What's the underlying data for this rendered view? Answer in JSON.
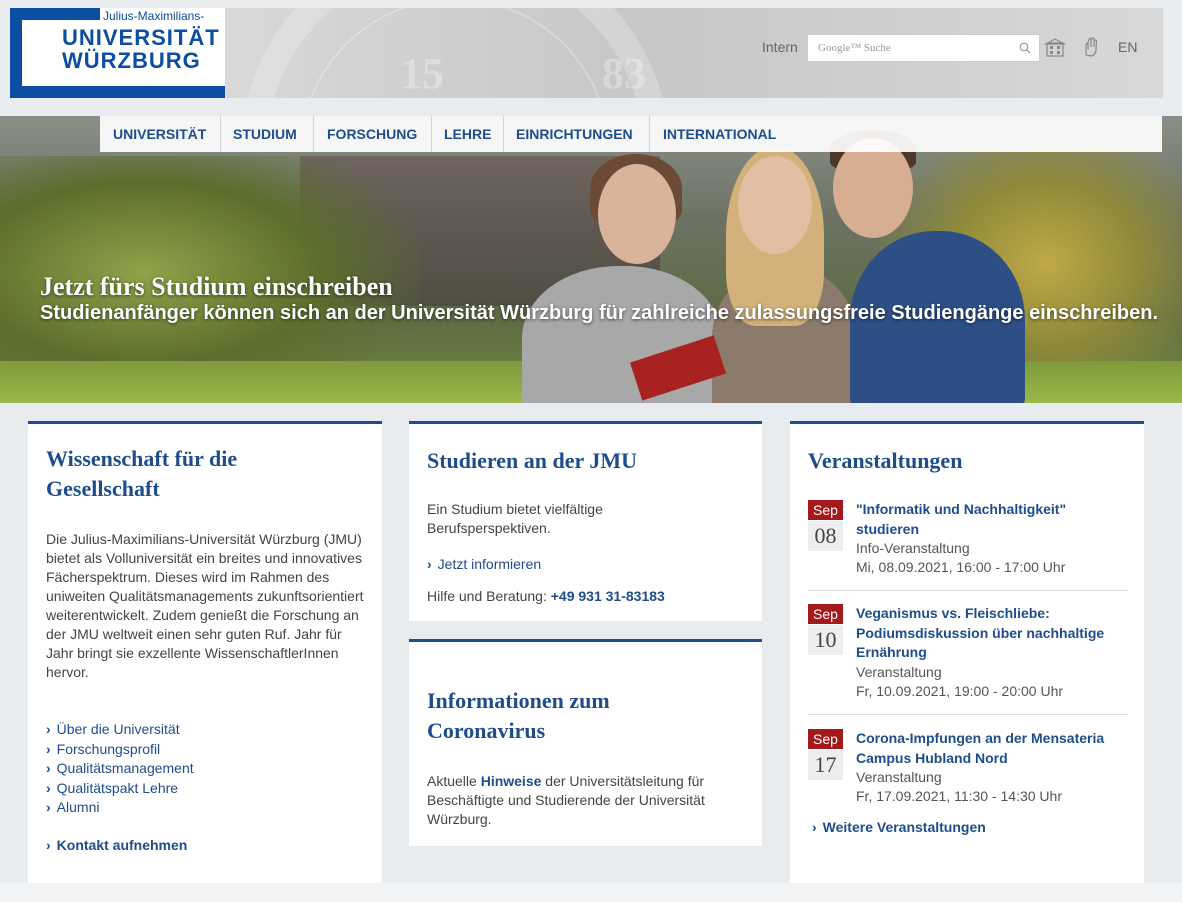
{
  "header": {
    "logo_small": "Julius-Maximilians-",
    "logo_line1": "UNIVERSITÄT",
    "logo_line2": "WÜRZBURG",
    "seal_left": "15",
    "seal_right": "83",
    "intern_label": "Intern",
    "search_placeholder": "Google™ Suche",
    "lang_label": "EN",
    "icons": [
      "search-icon",
      "building-icon",
      "sign-language-icon"
    ]
  },
  "nav": {
    "items": [
      "UNIVERSITÄT",
      "STUDIUM",
      "FORSCHUNG",
      "LEHRE",
      "EINRICHTUNGEN",
      "INTERNATIONAL"
    ]
  },
  "hero": {
    "title": "Jetzt fürs Studium einschreiben",
    "subtitle": "Studienanfänger können sich an der Universität Würzburg für zahlreiche zulassungsfreie Studiengänge einschreiben."
  },
  "col1": {
    "title": "Wissenschaft für die Gesellschaft",
    "body": "Die Julius-Maximilians-Universität Würzburg (JMU) bietet als Volluniversität ein breites und innovatives Fächerspektrum. Dieses wird im Rahmen des uniweiten Qualitätsmanagements zukunftsorientiert weiterentwickelt. Zudem genießt die Forschung an der JMU weltweit einen sehr guten Ruf. Jahr für Jahr bringt sie exzellente WissenschaftlerInnen hervor.",
    "links": [
      "Über die Universität",
      "Forschungsprofil",
      "Qualitätsmanagement",
      "Qualitätspakt Lehre",
      "Alumni"
    ],
    "contact": "Kontakt aufnehmen"
  },
  "col2": {
    "study": {
      "title": "Studieren an der JMU",
      "body": "Ein Studium bietet vielfältige Berufsperspektiven.",
      "link": "Jetzt informieren",
      "help_label": "Hilfe und Beratung:",
      "phone": "+49 931 31-83183"
    },
    "corona": {
      "title": "Informationen zum Coronavirus",
      "body_pre": "Aktuelle",
      "body_link": "Hinweise",
      "body_post": "der Universitätsleitung für Beschäftigte und Studierende der Universität Würzburg."
    }
  },
  "col3": {
    "title": "Veranstaltungen",
    "events": [
      {
        "month": "Sep",
        "day": "08",
        "title": "\"Informatik und Nachhaltigkeit\" studieren",
        "type": "Info-Veranstaltung",
        "date": "Mi, 08.09.2021, 16:00 - 17:00 Uhr"
      },
      {
        "month": "Sep",
        "day": "10",
        "title": "Veganismus vs. Fleischliebe: Podiumsdiskussion über nachhaltige Ernährung",
        "type": "Veranstaltung",
        "date": "Fr, 10.09.2021, 19:00 - 20:00 Uhr"
      },
      {
        "month": "Sep",
        "day": "17",
        "title": "Corona-Impfungen an der Mensateria Campus Hubland Nord",
        "type": "Veranstaltung",
        "date": "Fr, 17.09.2021, 11:30 - 14:30 Uhr"
      }
    ],
    "more": "Weitere Veranstaltungen"
  },
  "colors": {
    "brand_blue": "#1e4d8c",
    "logo_blue": "#0b4ea2",
    "event_red": "#a3191c"
  }
}
